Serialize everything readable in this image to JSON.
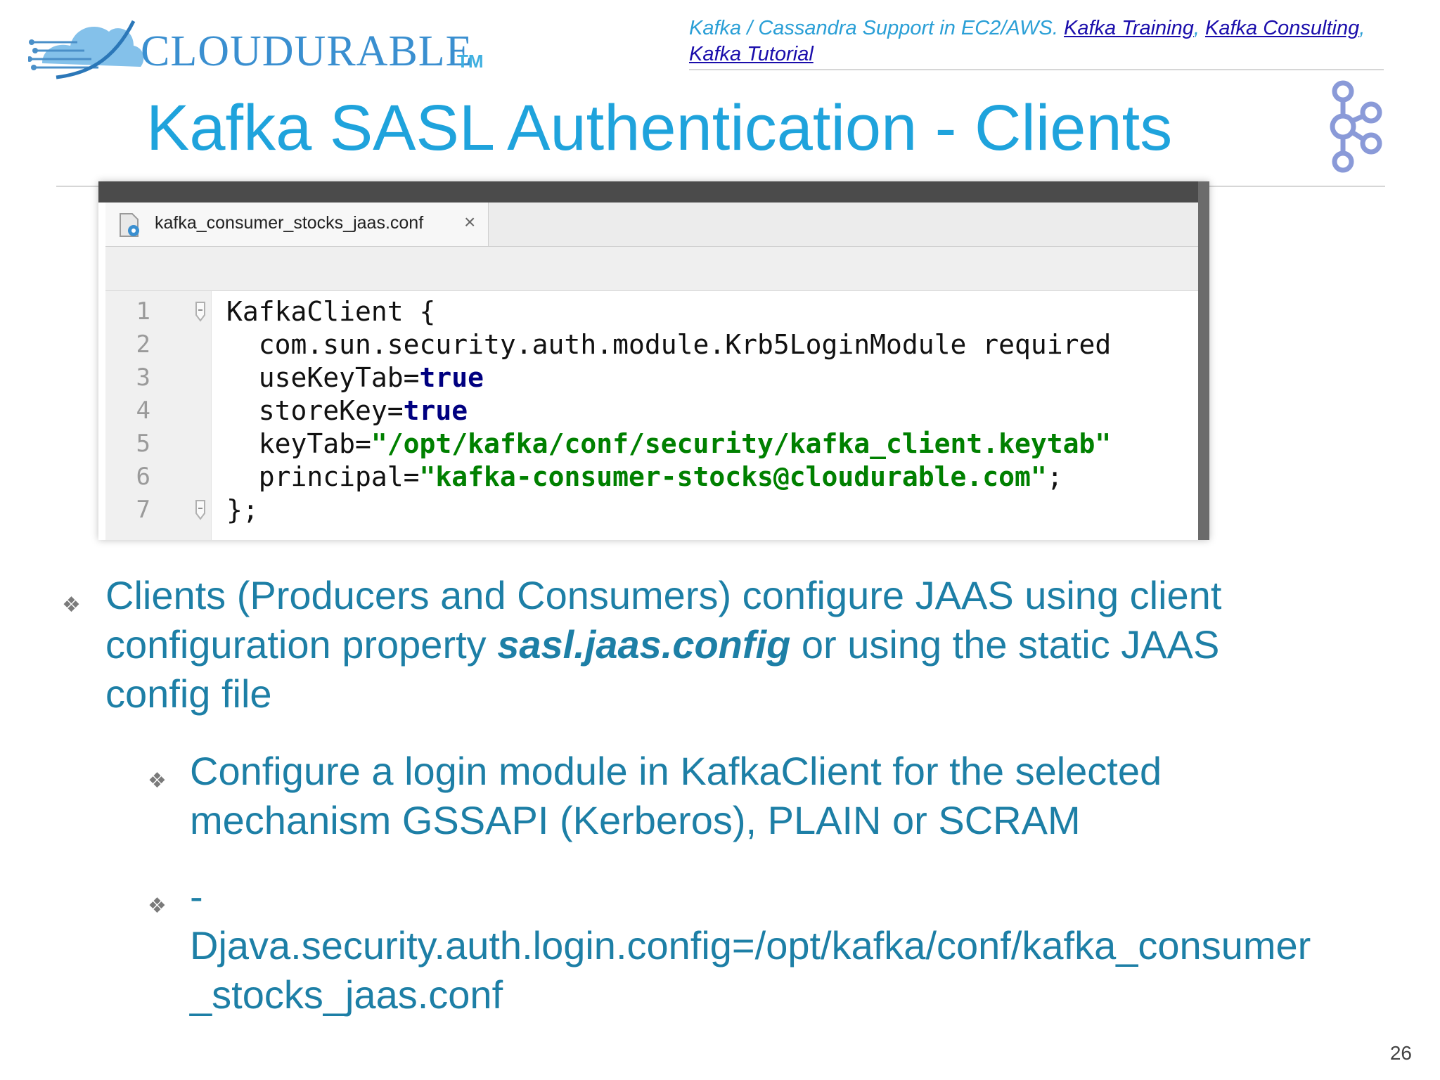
{
  "header": {
    "logo_text": "CLOUDURABLE",
    "logo_tm": "TM",
    "note_prefix": "Kafka / Cassandra Support in EC2/AWS. ",
    "links": [
      {
        "label": "Kafka Training"
      },
      {
        "label": "Kafka Consulting"
      },
      {
        "label": "Kafka Tutorial"
      }
    ]
  },
  "title": "Kafka SASL Authentication - Clients",
  "editor": {
    "tab_label": "kafka_consumer_stocks_jaas.conf",
    "close_glyph": "×",
    "lines": [
      {
        "num": "1",
        "tokens": [
          {
            "t": "KafkaClient {",
            "c": ""
          }
        ]
      },
      {
        "num": "2",
        "tokens": [
          {
            "t": "  com.sun.security.auth.module.Krb5LoginModule required",
            "c": ""
          }
        ]
      },
      {
        "num": "3",
        "tokens": [
          {
            "t": "  useKeyTab=",
            "c": ""
          },
          {
            "t": "true",
            "c": "kw"
          }
        ]
      },
      {
        "num": "4",
        "tokens": [
          {
            "t": "  storeKey=",
            "c": ""
          },
          {
            "t": "true",
            "c": "kw"
          }
        ]
      },
      {
        "num": "5",
        "tokens": [
          {
            "t": "  keyTab=",
            "c": ""
          },
          {
            "t": "\"/opt/kafka/conf/security/kafka_client.keytab\"",
            "c": "str"
          }
        ]
      },
      {
        "num": "6",
        "tokens": [
          {
            "t": "  principal=",
            "c": ""
          },
          {
            "t": "\"kafka-consumer-stocks@cloudurable.com\"",
            "c": "str"
          },
          {
            "t": ";",
            "c": ""
          }
        ]
      },
      {
        "num": "7",
        "tokens": [
          {
            "t": "};",
            "c": ""
          }
        ]
      }
    ]
  },
  "bullets": {
    "b1_part1": "Clients (Producers and Consumers) configure JAAS using client configuration property ",
    "b1_strong": "sasl.jaas.config",
    "b1_part2": " or using the static JAAS config file",
    "b2": "Configure a login module in KafkaClient for the selected mechanism GSSAPI (Kerberos), PLAIN or SCRAM",
    "b3_line1": "-",
    "b3_line2": "Djava.security.auth.login.config=/opt/kafka/conf/kafka_consumer",
    "b3_line3": "_stocks_jaas.conf",
    "mark": "❖"
  },
  "page_number": "26",
  "colors": {
    "title": "#1fa3dc",
    "bullet_text": "#1d7fa6",
    "link": "#1a0dab",
    "code_keyword": "#000080",
    "code_string": "#008000"
  }
}
